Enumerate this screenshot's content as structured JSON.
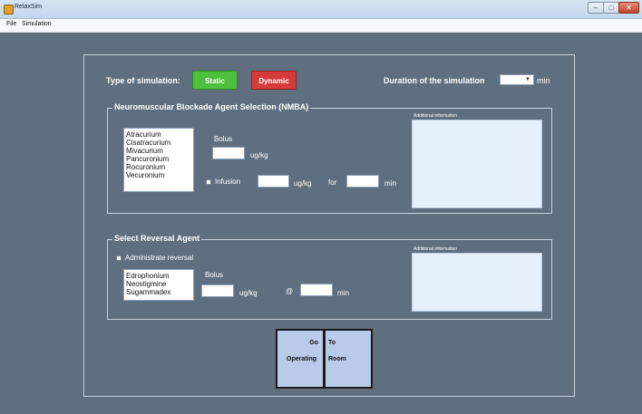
{
  "window": {
    "title": "RelaxSim",
    "controls": {
      "minimize": "–",
      "maximize": "□",
      "close": "✕"
    }
  },
  "menu": {
    "file": "File",
    "simulation": "Simulation"
  },
  "header": {
    "type_label": "Type of simulation:",
    "static_label": "Static",
    "dynamic_label": "Dynamic",
    "duration_label": "Duration of the simulation",
    "duration_value": "",
    "duration_unit": "min"
  },
  "nmba": {
    "legend": "Neuromuscular Blockade Agent Selection (NMBA)",
    "agents": [
      "Atracurium",
      "Cisatracurium",
      "Mivacurium",
      "Pancuronium",
      "Rocuronium",
      "Vecuronium"
    ],
    "bolus_label": "Bolus",
    "bolus_value": "",
    "bolus_unit": "ug/kg",
    "infusion_label": "Infusion",
    "infusion_value": "",
    "infusion_unit": "ug/kg",
    "for_label": "for",
    "for_value": "",
    "for_unit": "min",
    "info_label": "Additional information"
  },
  "reversal": {
    "legend": "Select Reversal Agent",
    "administrate_label": "Administrate reversal",
    "agents": [
      "Edrophonium",
      "Neostigmine",
      "Sugammadex"
    ],
    "bolus_label": "Bolus",
    "bolus_value": "",
    "bolus_unit": "ug/kg",
    "at_label": "@",
    "at_value": "",
    "at_unit": "min",
    "info_label": "Additional information"
  },
  "go_button": {
    "left_line1": "Go",
    "left_line2": "Operating",
    "right_line1": "To",
    "right_line2": "Room"
  },
  "colors": {
    "background": "#5f6f80",
    "static_button": "#4fbf3e",
    "dynamic_button": "#d63b3b",
    "go_button": "#b9cbe8",
    "info_box": "#e6f0fc"
  }
}
